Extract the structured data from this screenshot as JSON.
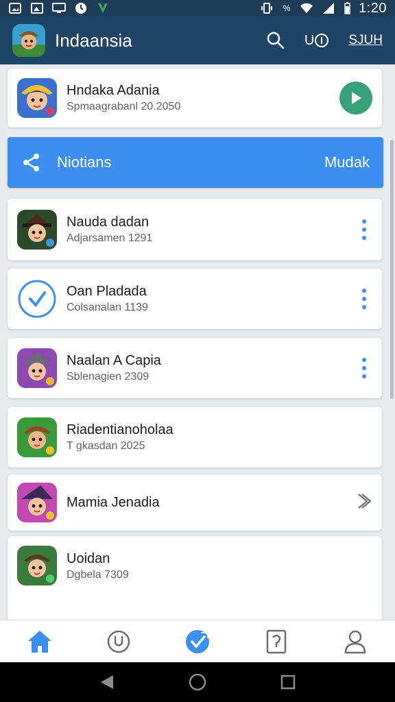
{
  "status_bar": {
    "time": "1:20",
    "battery_percent": "%",
    "left_icons": [
      "photo-icon",
      "gallery-icon",
      "screen-icon",
      "clock-icon",
      "shield-icon"
    ],
    "right_icons": [
      "vibrate-icon",
      "wifi-icon",
      "signal-icon",
      "battery-icon"
    ]
  },
  "app_bar": {
    "title": "Indaansia",
    "action_icon_label": "U",
    "action_text": "SJUH",
    "icons": [
      "app-logo-icon",
      "search-icon",
      "notification-icon"
    ]
  },
  "featured": {
    "title": "Hndaka Adania",
    "subtitle": "Spmaagrabanl 20.2050",
    "action_icon": "play-icon"
  },
  "share_bar": {
    "icon": "share-icon",
    "label": "Niotians",
    "right_label": "Mudak"
  },
  "list": [
    {
      "title": "Nauda dadan",
      "subtitle": "Adjarsamen 1291",
      "action_icon": "more-vertical-icon"
    },
    {
      "title": "Oan Pladada",
      "subtitle": "Colsanalan 1139",
      "action_icon": "more-vertical-icon"
    },
    {
      "title": "Naalan A Capia",
      "subtitle": "Sblenagien 2309",
      "action_icon": "more-vertical-icon"
    },
    {
      "title": "Riadentianoholaa",
      "subtitle": "T gkasdan 2025",
      "action_icon": ""
    },
    {
      "title": "Mamia Jenadia",
      "subtitle": "",
      "action_icon": "chevron-right-icon"
    },
    {
      "title": "Uoidan",
      "subtitle": "Dgbela 7309",
      "action_icon": ""
    }
  ],
  "bottom_nav": [
    "home-icon",
    "u-badge-icon",
    "check-icon",
    "document-icon",
    "profile-icon"
  ],
  "system_nav": [
    "back-icon",
    "home-circle-icon",
    "recents-icon"
  ],
  "colors": {
    "status_bar": "#1d3c58",
    "app_bar": "#1f4566",
    "accent": "#3b8ff0",
    "play": "#37a27a",
    "background": "#e9ecef"
  }
}
